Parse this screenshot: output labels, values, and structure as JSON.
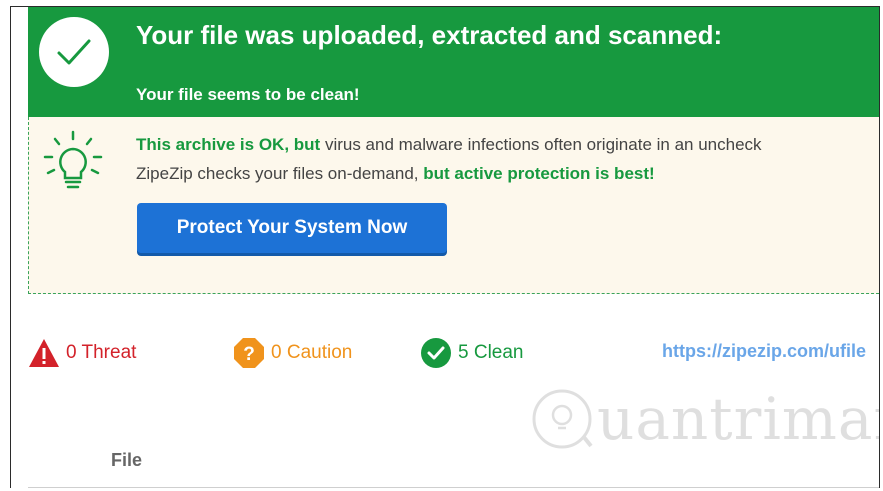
{
  "banner": {
    "title": "Your file was uploaded, extracted and scanned:",
    "subtitle": "Your file seems to be clean!"
  },
  "advice": {
    "line1_bold": "This archive is OK, but",
    "line1_rest": " virus and malware infections often originate in an uncheck",
    "line2_start": "ZipeZip checks your files on-demand, ",
    "line2_bold": "but active protection is best!",
    "button_label": "Protect Your System Now"
  },
  "summary": {
    "threat": "0 Threat",
    "caution": "0 Caution",
    "clean": "5 Clean",
    "url": "https://zipezip.com/ufile"
  },
  "table": {
    "file_header": "File"
  },
  "watermark": {
    "text": "uantrimang"
  },
  "colors": {
    "green": "#17993f",
    "blue": "#1d72d6",
    "red": "#d3222a",
    "orange": "#f0931c",
    "cream": "#fdf8ec"
  }
}
